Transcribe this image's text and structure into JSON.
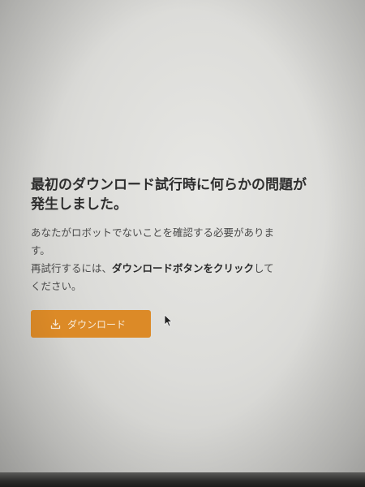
{
  "dialog": {
    "title_line1": "最初のダウンロード試行時に何らかの問題が",
    "title_line2": "発生しました。",
    "message_line1": "あなたがロボットでないことを確認する必要がありま",
    "message_line2": "す。",
    "retry_prefix": "再試行するには、",
    "retry_bold": "ダウンロードボタンをクリック",
    "retry_suffix": "して",
    "message_line4": "ください。"
  },
  "download_button": {
    "icon": "download-icon",
    "label": "ダウンロード"
  },
  "colors": {
    "button_bg": "#dc8a27",
    "button_text": "#f7ead8",
    "background": "#e3e3e0"
  }
}
